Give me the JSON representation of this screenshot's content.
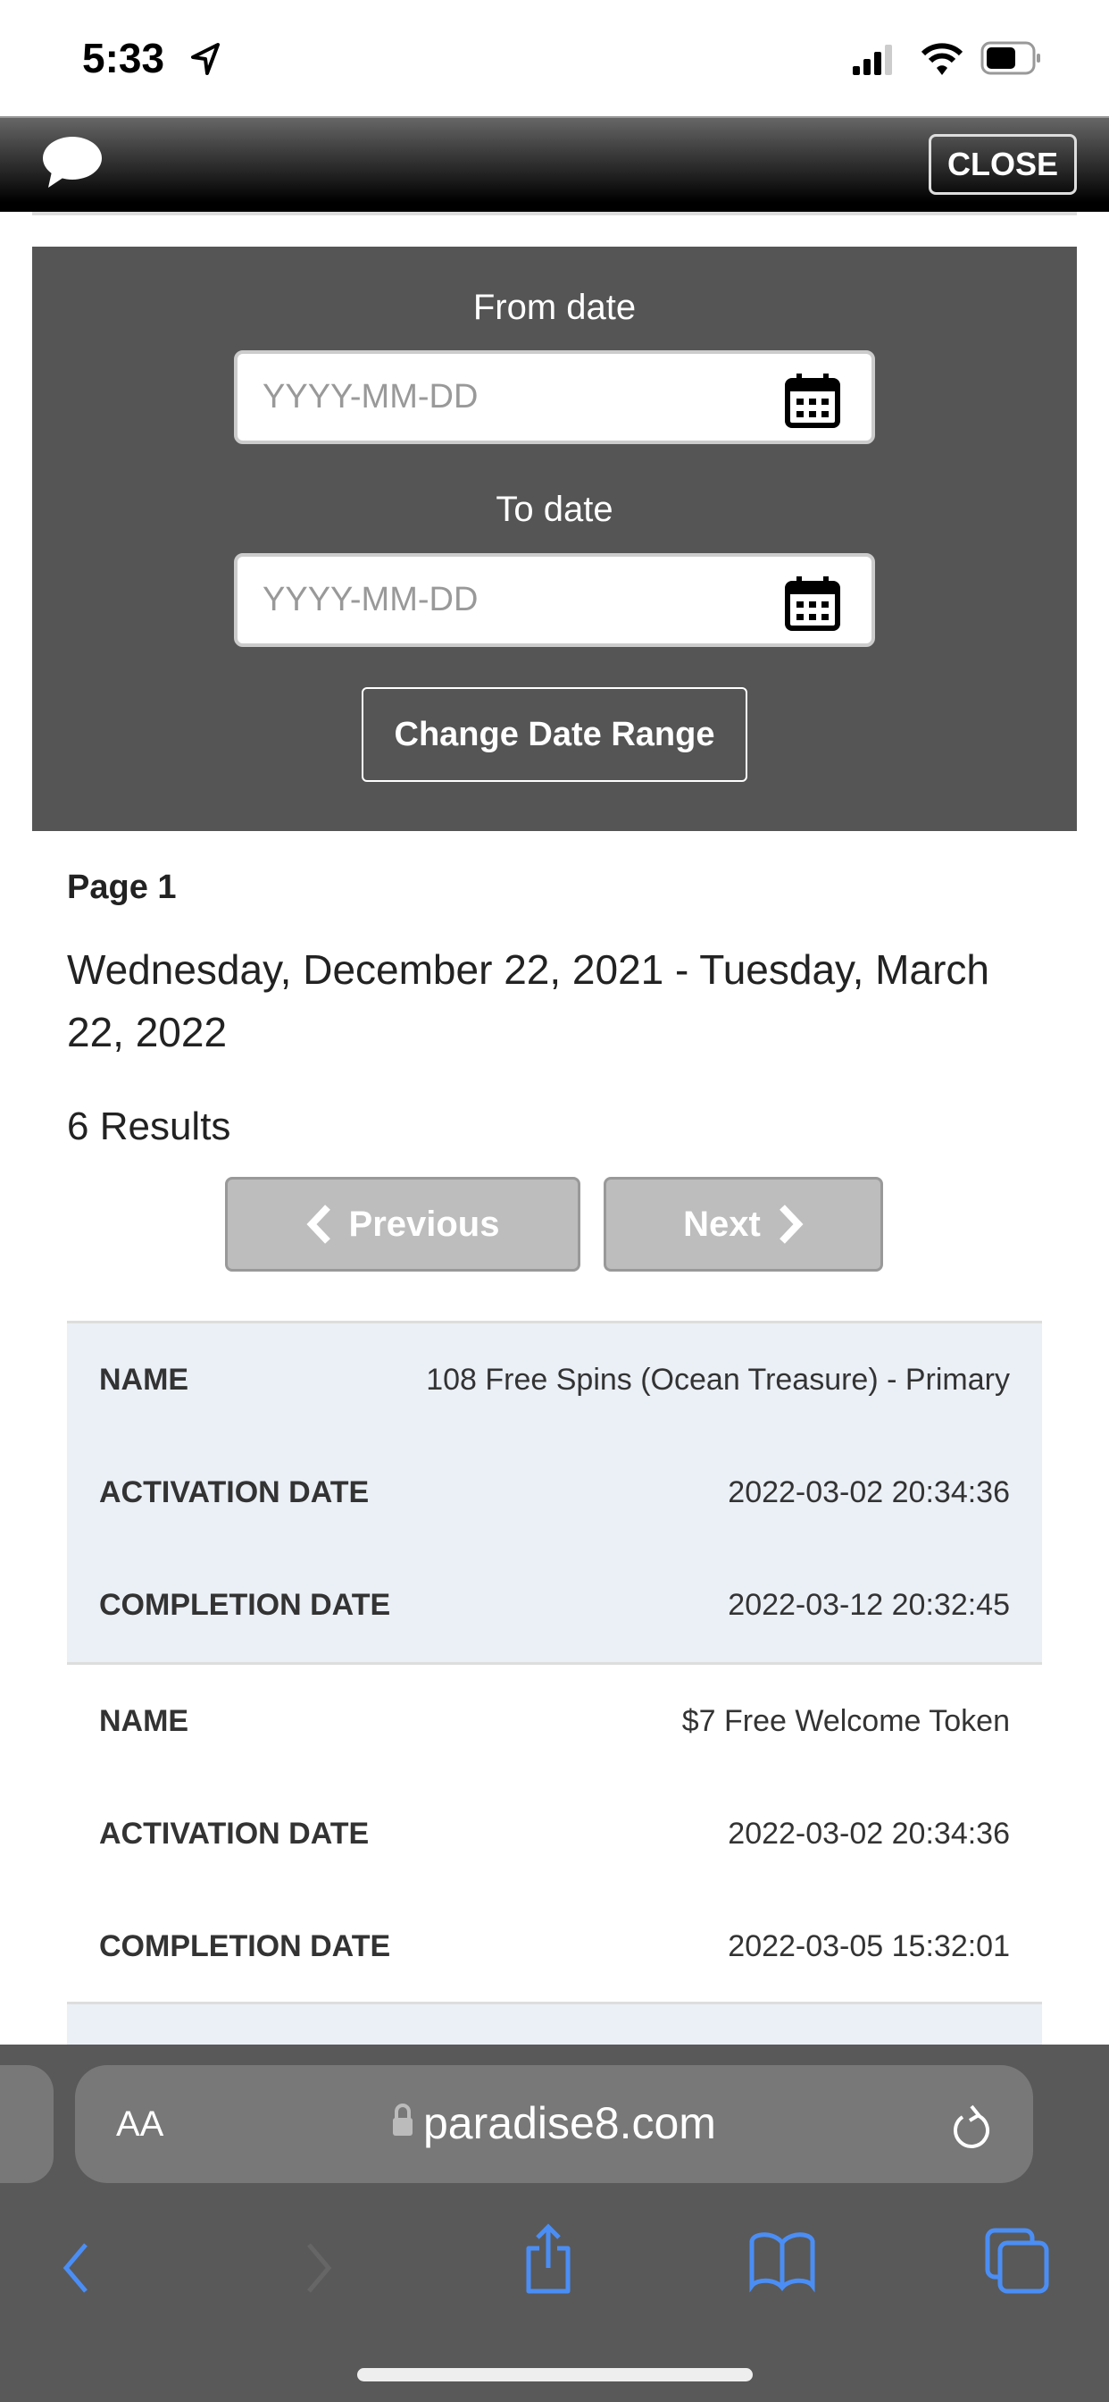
{
  "status": {
    "time": "5:33"
  },
  "header": {
    "close_label": "CLOSE",
    "chat_icon": "chat-bubble-icon"
  },
  "filter": {
    "from_label": "From date",
    "from_placeholder": "YYYY-MM-DD",
    "from_value": "",
    "to_label": "To date",
    "to_placeholder": "YYYY-MM-DD",
    "to_value": "",
    "change_label": "Change Date Range"
  },
  "results": {
    "page": "Page 1",
    "range": "Wednesday, December 22, 2021 - Tuesday, March 22, 2022",
    "count": "6 Results",
    "prev_label": "Previous",
    "next_label": "Next",
    "items": [
      {
        "name_label": "NAME",
        "name": "108 Free Spins (Ocean Treasure) - Primary",
        "act_label": "ACTIVATION DATE",
        "activation": "2022-03-02 20:34:36",
        "comp_label": "COMPLETION DATE",
        "completion": "2022-03-12 20:32:45"
      },
      {
        "name_label": "NAME",
        "name": "$7 Free Welcome Token",
        "act_label": "ACTIVATION DATE",
        "activation": "2022-03-02 20:34:36",
        "comp_label": "COMPLETION DATE",
        "completion": "2022-03-05 15:32:01"
      }
    ]
  },
  "browser": {
    "text_size": "AA",
    "url": "paradise8.com"
  },
  "colors": {
    "panel": "#555555",
    "row_alt": "#ebf0f7",
    "ios_blue": "#4a8ef5"
  }
}
